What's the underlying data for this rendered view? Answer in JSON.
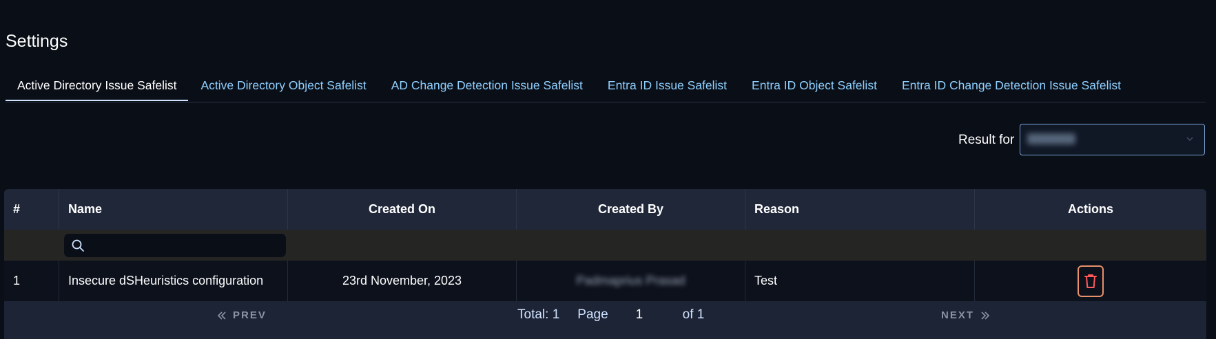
{
  "page": {
    "title": "Settings"
  },
  "tabs": [
    {
      "label": "Active Directory Issue Safelist",
      "active": true
    },
    {
      "label": "Active Directory Object Safelist",
      "active": false
    },
    {
      "label": "AD Change Detection Issue Safelist",
      "active": false
    },
    {
      "label": "Entra ID Issue Safelist",
      "active": false
    },
    {
      "label": "Entra ID Object Safelist",
      "active": false
    },
    {
      "label": "Entra ID Change Detection Issue Safelist",
      "active": false
    }
  ],
  "filter": {
    "result_for_label": "Result for",
    "selected_value_blurred": "ad.local",
    "chevron_icon": "chevron-down-icon"
  },
  "table": {
    "columns": [
      "#",
      "Name",
      "Created On",
      "Created By",
      "Reason",
      "Actions"
    ],
    "search_placeholder": "",
    "rows": [
      {
        "index": "1",
        "name": "Insecure dSHeuristics configuration",
        "created_on": "23rd November, 2023",
        "created_by_blurred": "Padmaprius Prasad",
        "reason": "Test",
        "action_icon": "trash-icon"
      }
    ]
  },
  "pagination": {
    "prev_label": "PREV",
    "next_label": "NEXT",
    "total_label": "Total: 1",
    "page_label": "Page",
    "page_value": "1",
    "of_label": "of 1"
  },
  "colors": {
    "background": "#0a0e17",
    "tab_link": "#8fd0ff",
    "delete_border": "#e8916a",
    "delete_icon": "#ff5a5a"
  }
}
